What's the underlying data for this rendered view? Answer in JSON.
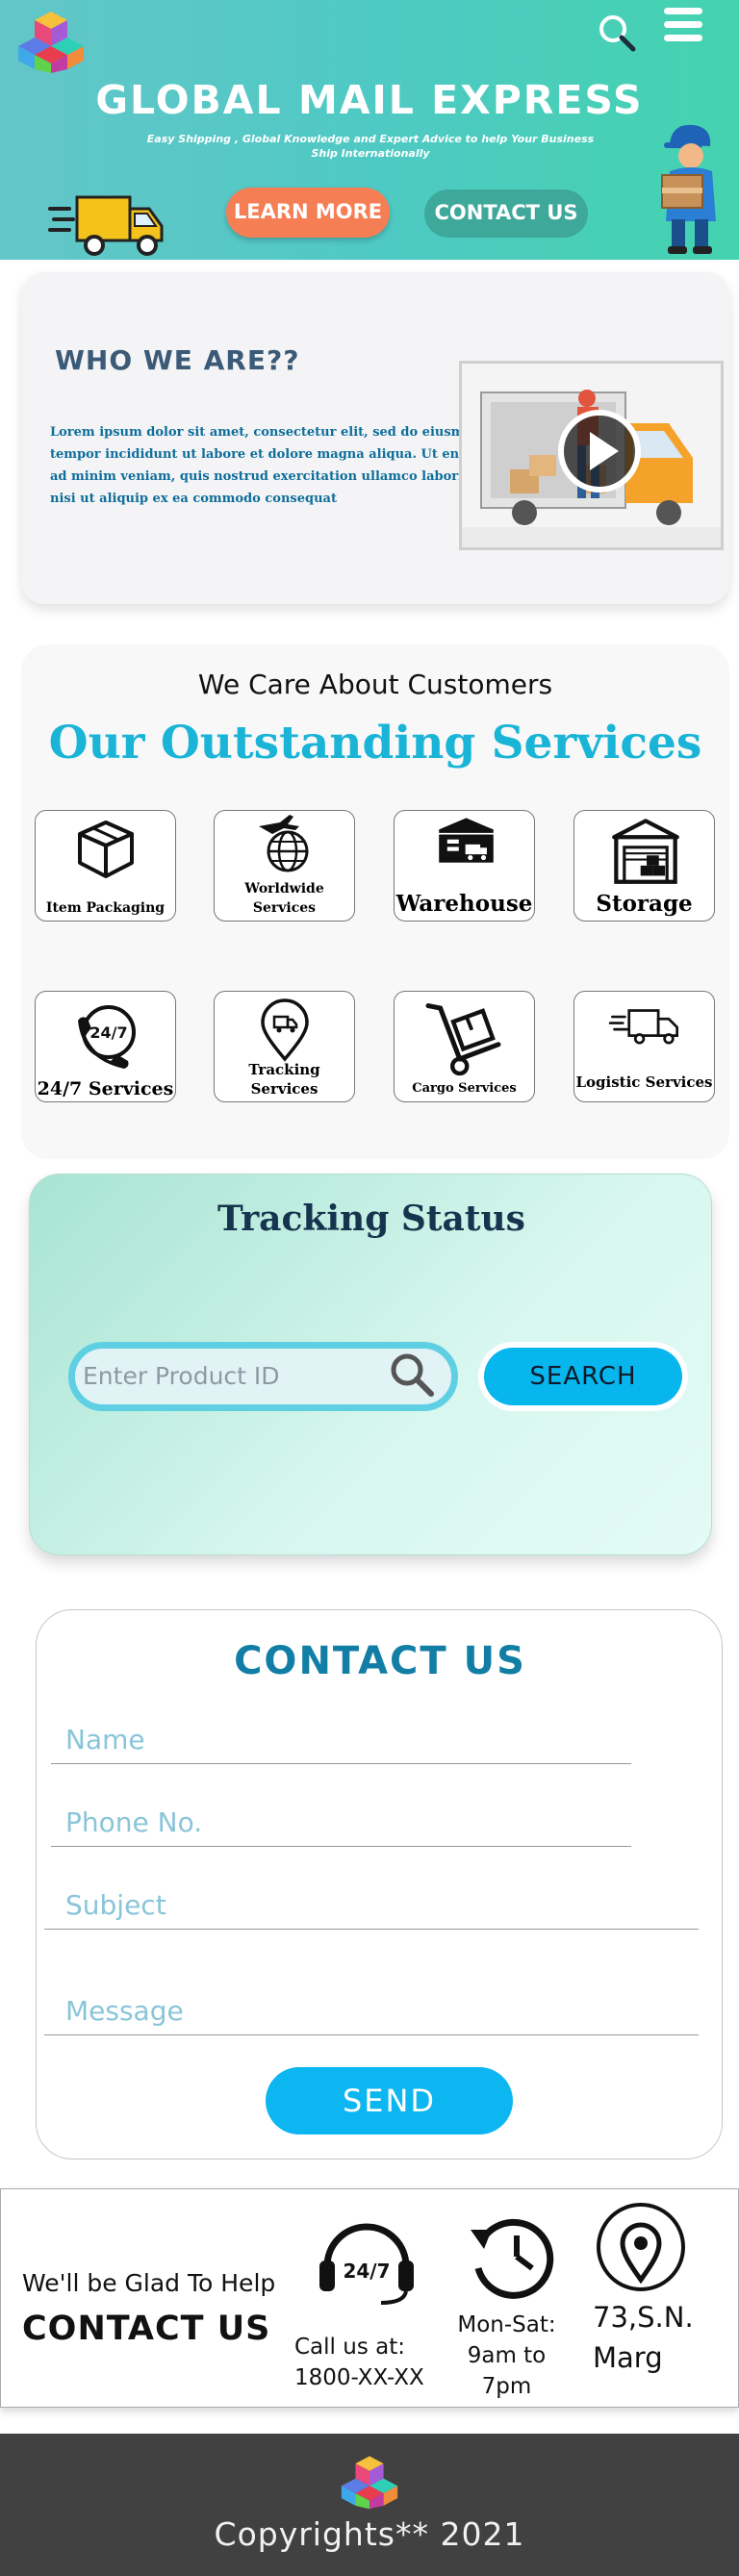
{
  "header": {
    "title": "GLOBAL MAIL EXPRESS",
    "subtitle": "Easy Shipping , Global Knowledge and Expert Advice to help Your Business Ship Internationally",
    "learn_more": "LEARN MORE",
    "contact_us": "CONTACT US"
  },
  "about": {
    "title": "WHO WE ARE??",
    "text": "Lorem ipsum dolor sit amet, consectetur elit, sed do eiusmod tempor incididunt ut labore et dolore magna aliqua. Ut enim ad minim veniam, quis nostrud exercitation ullamco laboris nisi ut aliquip ex ea commodo consequat"
  },
  "services": {
    "tagline": "We Care About Customers",
    "title": "Our Outstanding Services",
    "items": [
      {
        "label": "Item Packaging",
        "icon": "box-icon"
      },
      {
        "label": "Worldwide Services",
        "icon": "globe-plane-icon"
      },
      {
        "label": "Warehouse",
        "icon": "warehouse-icon"
      },
      {
        "label": "Storage",
        "icon": "storage-icon"
      },
      {
        "label": "24/7 Services",
        "icon": "phone-24-7-icon"
      },
      {
        "label": "Tracking Services",
        "icon": "location-pin-truck-icon"
      },
      {
        "label": "Cargo Services",
        "icon": "hand-truck-icon"
      },
      {
        "label": "Logistic Services",
        "icon": "delivery-truck-icon"
      }
    ]
  },
  "tracking": {
    "title": "Tracking Status",
    "placeholder": "Enter Product ID",
    "button": "SEARCH"
  },
  "contact_form": {
    "title": "CONTACT US",
    "name_placeholder": "Name",
    "phone_placeholder": "Phone No.",
    "subject_placeholder": "Subject",
    "message_placeholder": "Message",
    "send": "SEND"
  },
  "contact_strip": {
    "glad": "We'll be Glad To Help",
    "title": "CONTACT US",
    "call_line1": "Call us at:",
    "call_line2": "1800-XX-XX",
    "hours_line1": "Mon-Sat:",
    "hours_line2": "9am to 7pm",
    "address_line1": "73,S.N.",
    "address_line2": "Marg",
    "headset_badge": "24/7"
  },
  "footer": {
    "copyright": "Copyrights** 2021"
  },
  "colors": {
    "header_gradient_start": "#63c6c8",
    "header_gradient_end": "#44d3b0",
    "accent_orange": "#f57e55",
    "accent_teal": "#3ea89b",
    "services_title": "#19b4d6",
    "button_blue": "#08b6ee",
    "footer_bg": "#414141"
  }
}
